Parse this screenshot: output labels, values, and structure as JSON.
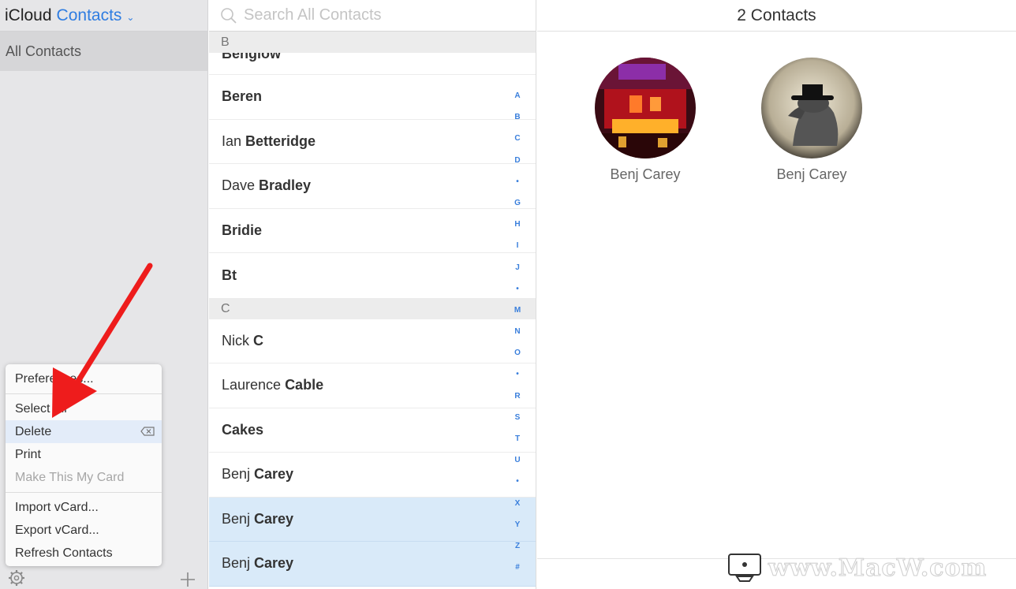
{
  "sidebar": {
    "app_name": "iCloud",
    "section_name": "Contacts",
    "groups": [
      "All Contacts"
    ]
  },
  "menu": {
    "items": [
      {
        "label": "Preferences...",
        "state": "normal"
      },
      {
        "label": "Select All",
        "state": "normal"
      },
      {
        "label": "Delete",
        "state": "active"
      },
      {
        "label": "Print",
        "state": "normal"
      },
      {
        "label": "Make This My Card",
        "state": "disabled"
      },
      {
        "label": "Import vCard...",
        "state": "normal"
      },
      {
        "label": "Export vCard...",
        "state": "normal"
      },
      {
        "label": "Refresh Contacts",
        "state": "normal"
      }
    ]
  },
  "search": {
    "placeholder": "Search All Contacts"
  },
  "list": {
    "section_b": "B",
    "section_c": "C",
    "partial_row": "Benglow",
    "rows_b": [
      {
        "first": "",
        "last": "Beren"
      },
      {
        "first": "Ian",
        "last": "Betteridge"
      },
      {
        "first": "Dave",
        "last": "Bradley"
      },
      {
        "first": "",
        "last": "Bridie"
      },
      {
        "first": "",
        "last": "Bt"
      }
    ],
    "rows_c": [
      {
        "first": "Nick",
        "last": "C"
      },
      {
        "first": "Laurence",
        "last": "Cable"
      },
      {
        "first": "",
        "last": "Cakes"
      },
      {
        "first": "Benj",
        "last": "Carey"
      },
      {
        "first": "Benj",
        "last": "Carey"
      },
      {
        "first": "Benj",
        "last": "Carey"
      }
    ],
    "index_letters": [
      "A",
      "B",
      "C",
      "D",
      "•",
      "G",
      "H",
      "I",
      "J",
      "•",
      "M",
      "N",
      "O",
      "•",
      "R",
      "S",
      "T",
      "U",
      "•",
      "X",
      "Y",
      "Z",
      "#"
    ]
  },
  "detail": {
    "count_label": "2 Contacts",
    "cards": [
      {
        "name": "Benj Carey"
      },
      {
        "name": "Benj Carey"
      }
    ]
  },
  "watermark": {
    "text": "www.MacW.com"
  }
}
